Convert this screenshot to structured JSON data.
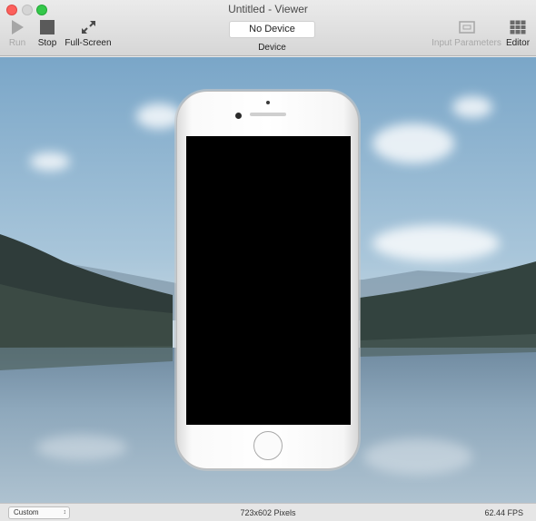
{
  "window": {
    "title": "Untitled - Viewer"
  },
  "toolbar": {
    "run_label": "Run",
    "stop_label": "Stop",
    "fullscreen_label": "Full-Screen",
    "device_value": "No Device",
    "device_label": "Device",
    "input_params_label": "Input Parameters",
    "editor_label": "Editor"
  },
  "statusbar": {
    "size_mode": "Custom",
    "resolution": "723x602 Pixels",
    "fps": "62.44 FPS"
  },
  "colors": {
    "close": "#fc605c",
    "maximize": "#34c84a",
    "screen": "#000000"
  }
}
